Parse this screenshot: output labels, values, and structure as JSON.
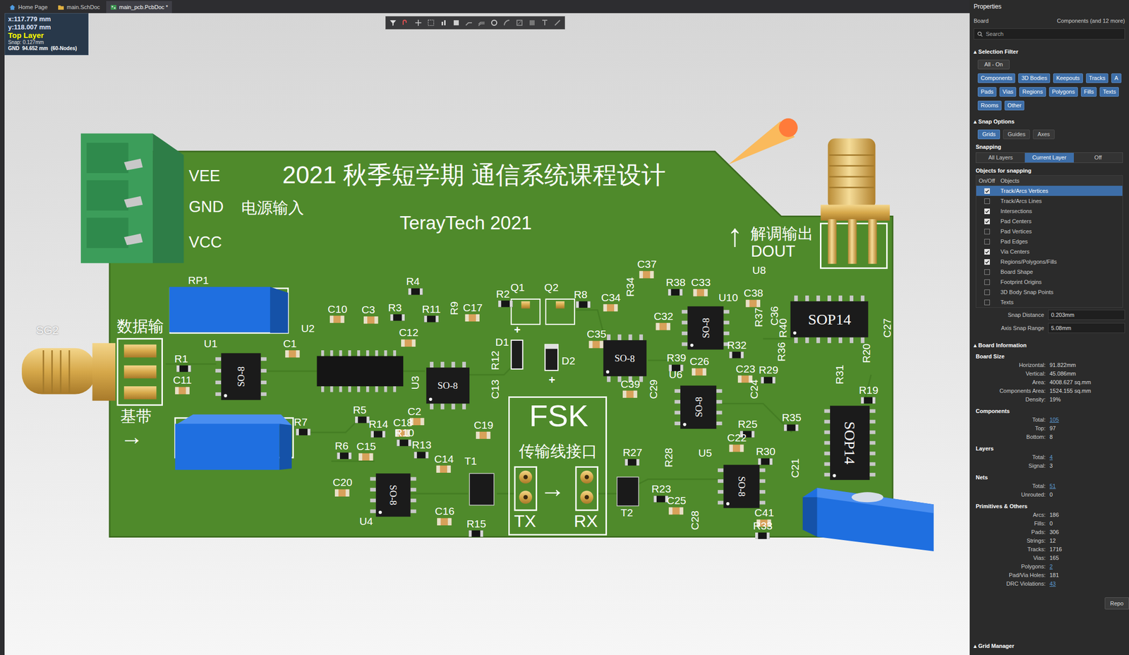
{
  "tabs": [
    {
      "label": "Home Page",
      "selected": false
    },
    {
      "label": "main.SchDoc",
      "selected": false
    },
    {
      "label": "main_pcb.PcbDoc *",
      "selected": true
    }
  ],
  "hud": {
    "x": "x:117.779 mm",
    "y": "y:118.007 mm",
    "layer": "Top Layer",
    "snap": "Snap: 0.127mm",
    "net": "GND  94.652 mm  (60-Nodes)"
  },
  "pcb": {
    "title": "2021 秋季短学期 通信系统课程设计",
    "brand": "TerayTech 2021",
    "power_pins": [
      "VEE",
      "GND",
      "VCC"
    ],
    "power_label": "电源输入",
    "dout_arrow": "↑",
    "dout_label": "解调输出",
    "dout_net": "DOUT",
    "data_in": "数据输",
    "baseband": "基带",
    "baseband_arrow": "→",
    "connector": "SG2",
    "polarity_marks": [
      "+",
      "+"
    ],
    "fsk": {
      "title": "FSK",
      "subtitle": "传输线接口",
      "tx": "TX",
      "rx": "RX",
      "arrow": "→"
    },
    "designators": [
      "RP1",
      "U1",
      "C1",
      "R1",
      "C11",
      "U2",
      "C10",
      "C3",
      "R4",
      "R3",
      "R11",
      "R9",
      "C17",
      "C12",
      "U3",
      "R12",
      "C13",
      "R5",
      "C2",
      "R14",
      "C18",
      "R10",
      "R6",
      "C15",
      "R13",
      "C14",
      "C19",
      "R7",
      "C20",
      "U4",
      "C16",
      "T1",
      "R15",
      "R2",
      "Q1",
      "Q2",
      "R8",
      "D1",
      "D2",
      "C37",
      "R34",
      "C34",
      "C35",
      "C32",
      "R38",
      "C33",
      "U10",
      "C38",
      "R37",
      "C36",
      "U8",
      "R39",
      "C26",
      "U6",
      "C39",
      "C29",
      "R32",
      "C23",
      "R29",
      "R36",
      "R40",
      "C24",
      "R25",
      "R35",
      "C22",
      "R30",
      "R28",
      "R27",
      "R23",
      "U5",
      "C25",
      "C28",
      "C41",
      "R33",
      "C21",
      "R31",
      "R19",
      "R20",
      "C27",
      "T2"
    ],
    "chips": [
      "SO-8",
      "SO-8",
      "SO-8",
      "SO-8",
      "SO-8",
      "SO-8",
      "SO-8",
      "SOP14",
      "SOP14"
    ]
  },
  "panel": {
    "title": "Properties",
    "context": "Board",
    "context_filter": "Components (and 12 more)",
    "search": {
      "placeholder": "Search"
    },
    "selection_filter": {
      "title": "▴ Selection Filter",
      "all": "All - On",
      "filter_rows": [
        [
          {
            "label": "Components",
            "selected": true
          },
          {
            "label": "3D Bodies",
            "selected": true
          },
          {
            "label": "Keepouts",
            "selected": true
          },
          {
            "label": "Tracks",
            "selected": true
          },
          {
            "label": "A",
            "selected": true
          }
        ],
        [
          {
            "label": "Pads",
            "selected": true
          },
          {
            "label": "Vias",
            "selected": true
          },
          {
            "label": "Regions",
            "selected": true
          },
          {
            "label": "Polygons",
            "selected": true
          },
          {
            "label": "Fills",
            "selected": true
          },
          {
            "label": "Texts",
            "selected": true
          }
        ],
        [
          {
            "label": "Rooms",
            "selected": true
          },
          {
            "label": "Other",
            "selected": true
          }
        ]
      ]
    },
    "snap_options": {
      "title": "▴ Snap Options",
      "modes": [
        {
          "label": "Grids",
          "selected": true
        },
        {
          "label": "Guides",
          "selected": false
        },
        {
          "label": "Axes",
          "selected": false
        }
      ],
      "snapping_label": "Snapping",
      "layers": [
        {
          "label": "All Layers",
          "selected": false
        },
        {
          "label": "Current Layer",
          "selected": true
        },
        {
          "label": "Off",
          "selected": false
        }
      ],
      "objects_title": "Objects for snapping",
      "columns": [
        "On/Off",
        "Objects"
      ],
      "objects": [
        {
          "label": "Track/Arcs Vertices",
          "checked": true,
          "selected": true
        },
        {
          "label": "Track/Arcs Lines",
          "checked": false,
          "selected": false
        },
        {
          "label": "Intersections",
          "checked": true,
          "selected": false
        },
        {
          "label": "Pad Centers",
          "checked": true,
          "selected": false
        },
        {
          "label": "Pad Vertices",
          "checked": false,
          "selected": false
        },
        {
          "label": "Pad Edges",
          "checked": false,
          "selected": false
        },
        {
          "label": "Via Centers",
          "checked": true,
          "selected": false
        },
        {
          "label": "Regions/Polygons/Fills",
          "checked": true,
          "selected": false
        },
        {
          "label": "Board Shape",
          "checked": false,
          "selected": false
        },
        {
          "label": "Footprint Origins",
          "checked": false,
          "selected": false
        },
        {
          "label": "3D Body Snap Points",
          "checked": false,
          "selected": false
        },
        {
          "label": "Texts",
          "checked": false,
          "selected": false
        }
      ],
      "fields": [
        {
          "label": "Snap Distance",
          "value": "0.203mm"
        },
        {
          "label": "Axis Snap Range",
          "value": "5.08mm"
        }
      ]
    },
    "board_info": {
      "title": "▴ Board Information",
      "groups": [
        {
          "title": "Board Size",
          "rows": [
            {
              "label": "Horizontal:",
              "value": "91.822mm",
              "link": false
            },
            {
              "label": "Vertical:",
              "value": "45.086mm",
              "link": false
            },
            {
              "label": "Area:",
              "value": "4008.627 sq.mm",
              "link": false
            },
            {
              "label": "Components Area:",
              "value": "1524.155 sq.mm",
              "link": false
            },
            {
              "label": "Density:",
              "value": "19%",
              "link": false
            }
          ]
        },
        {
          "title": "Components",
          "rows": [
            {
              "label": "Total:",
              "value": "105",
              "link": true
            },
            {
              "label": "Top:",
              "value": "97",
              "link": false
            },
            {
              "label": "Bottom:",
              "value": "8",
              "link": false
            }
          ]
        },
        {
          "title": "Layers",
          "rows": [
            {
              "label": "Total:",
              "value": "4",
              "link": true
            },
            {
              "label": "Signal:",
              "value": "3",
              "link": false
            }
          ]
        },
        {
          "title": "Nets",
          "rows": [
            {
              "label": "Total:",
              "value": "51",
              "link": true
            },
            {
              "label": "Unrouted:",
              "value": "0",
              "link": false
            }
          ]
        },
        {
          "title": "Primitives & Others",
          "rows": [
            {
              "label": "Arcs:",
              "value": "186",
              "link": false
            },
            {
              "label": "Fills:",
              "value": "0",
              "link": false
            },
            {
              "label": "Pads:",
              "value": "306",
              "link": false
            },
            {
              "label": "Strings:",
              "value": "12",
              "link": false
            },
            {
              "label": "Tracks:",
              "value": "1716",
              "link": false
            },
            {
              "label": "Vias:",
              "value": "165",
              "link": false
            },
            {
              "label": "Polygons:",
              "value": "2",
              "link": true
            },
            {
              "label": "Pad/Via Holes:",
              "value": "181",
              "link": false
            },
            {
              "label": "DRC Violations:",
              "value": "43",
              "link": true
            }
          ]
        }
      ]
    },
    "report_button": "Repo",
    "grid_manager": "▴ Grid Manager"
  }
}
